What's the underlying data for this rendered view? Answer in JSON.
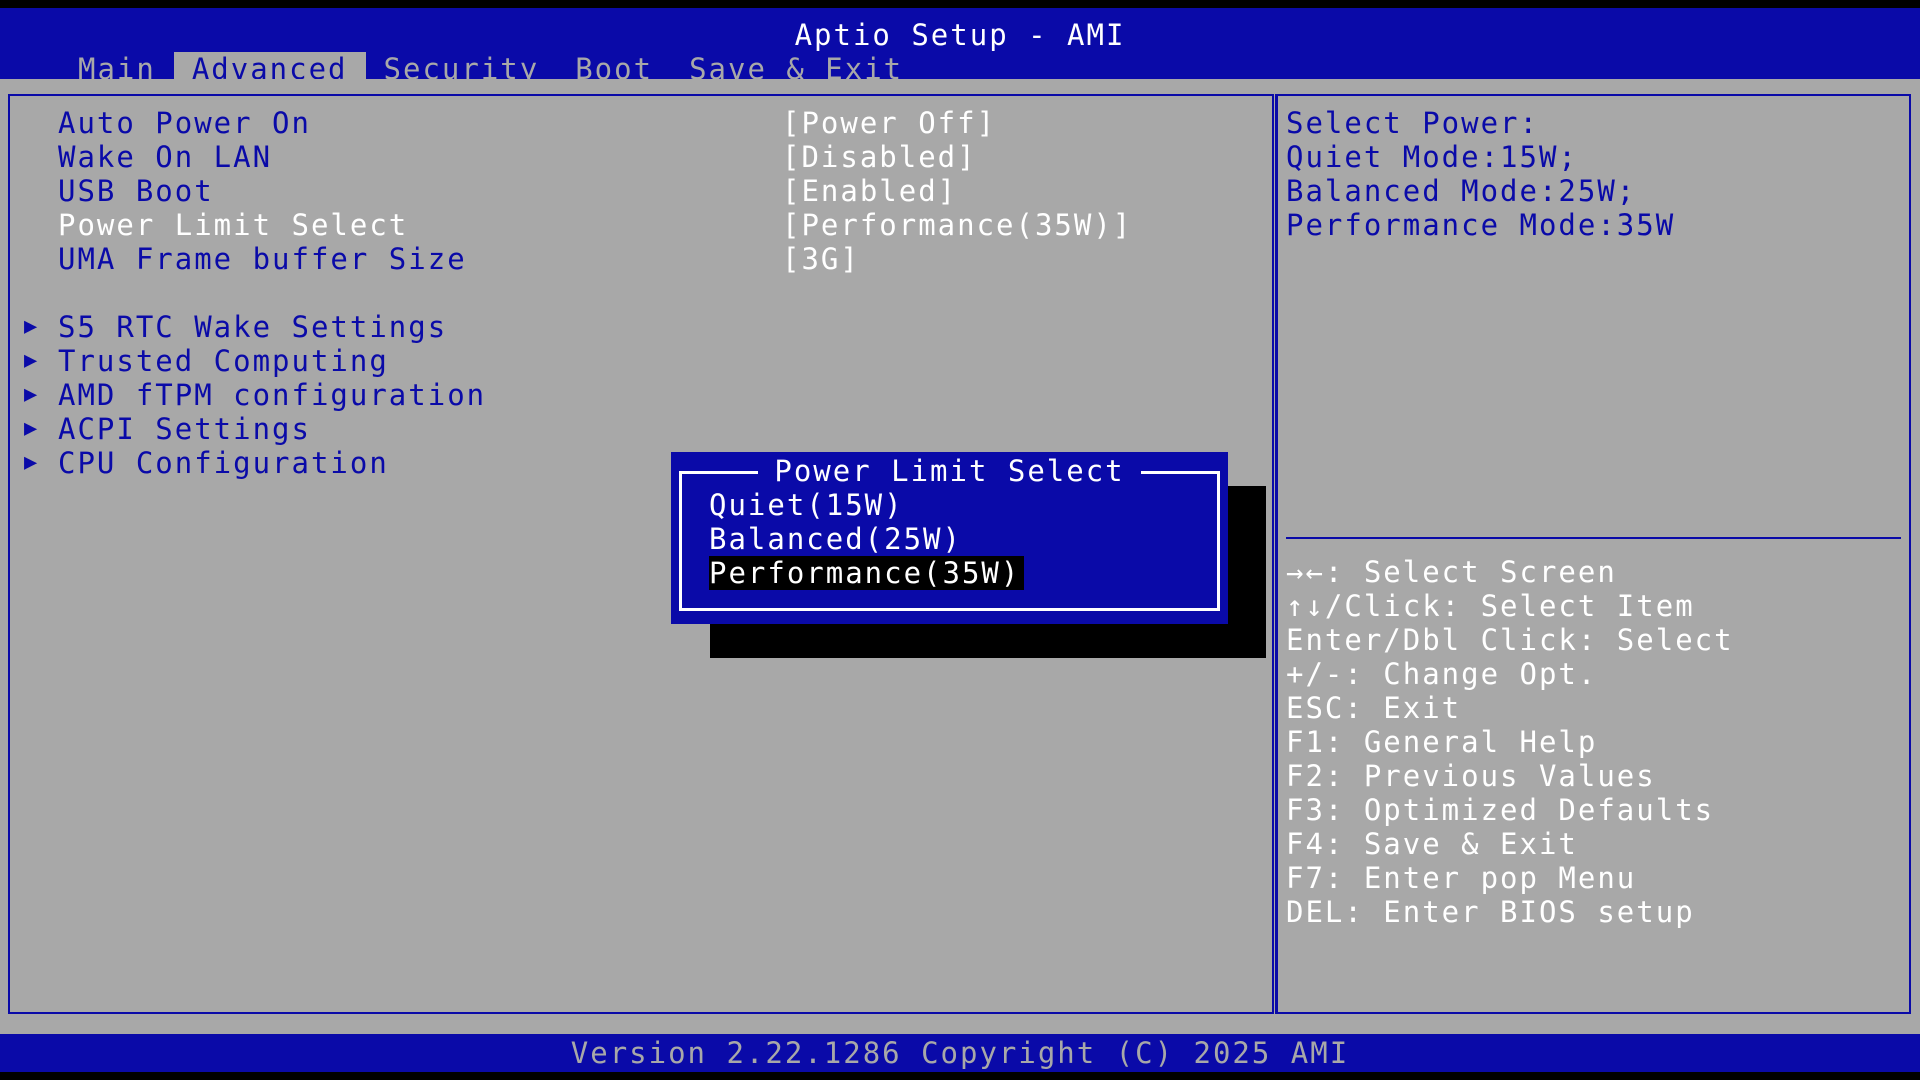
{
  "header": {
    "title": "Aptio Setup - AMI",
    "tabs": [
      {
        "label": "Main"
      },
      {
        "label": "Advanced"
      },
      {
        "label": "Security"
      },
      {
        "label": "Boot"
      },
      {
        "label": "Save & Exit"
      }
    ]
  },
  "settings": [
    {
      "label": "Auto Power On",
      "value": "[Power Off]"
    },
    {
      "label": "Wake On LAN",
      "value": "[Disabled]"
    },
    {
      "label": "USB Boot",
      "value": "[Enabled]"
    },
    {
      "label": "Power Limit Select",
      "value": "[Performance(35W)]"
    },
    {
      "label": "UMA Frame buffer Size",
      "value": "[3G]"
    }
  ],
  "submenus": [
    {
      "label": "S5 RTC Wake Settings"
    },
    {
      "label": "Trusted Computing"
    },
    {
      "label": "AMD fTPM configuration"
    },
    {
      "label": "ACPI Settings"
    },
    {
      "label": "CPU Configuration"
    }
  ],
  "help": {
    "lines": [
      "Select Power:",
      "Quiet Mode:15W;",
      "Balanced Mode:25W;",
      "Performance Mode:35W"
    ]
  },
  "keys": [
    "→←: Select Screen",
    "↑↓/Click: Select Item",
    "Enter/Dbl Click: Select",
    "+/-: Change Opt.",
    "ESC: Exit",
    "F1: General Help",
    "F2: Previous Values",
    "F3: Optimized Defaults",
    "F4: Save & Exit",
    "F7: Enter pop Menu",
    "DEL: Enter BIOS setup"
  ],
  "popup": {
    "title": "Power Limit Select",
    "options": [
      "Quiet(15W)",
      "Balanced(25W)",
      "Performance(35W)"
    ]
  },
  "footer": {
    "text": "Version 2.22.1286 Copyright (C) 2025 AMI"
  },
  "colors": {
    "bios_blue": "#0a0aa8",
    "bios_gray": "#a8a8a8",
    "white": "#ffffff",
    "black": "#000000"
  }
}
